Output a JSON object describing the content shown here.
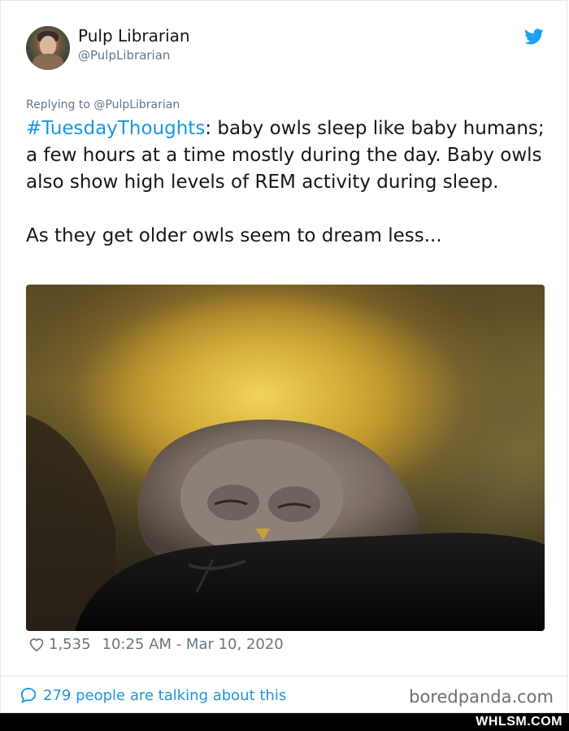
{
  "tweet": {
    "author_name": "Pulp Librarian",
    "author_handle": "@PulpLibrarian",
    "replying_to": "Replying to @PulpLibrarian",
    "hashtag": "#TuesdayThoughts",
    "text_part1": ": baby owls sleep like baby humans; a few hours at a time mostly during the day. Baby owls also show high levels of REM activity during sleep.",
    "text_part2": "As they get older owls seem to dream less...",
    "likes": "1,535",
    "timestamp": "10:25 AM - Mar 10, 2020",
    "talking": "279 people are talking about this"
  },
  "footer": {
    "source": "boredpanda.com",
    "watermark": "WHLSM.COM"
  },
  "icons": {
    "brand": "twitter-bird-icon",
    "like": "heart-icon",
    "reply": "speech-bubble-icon"
  },
  "colors": {
    "twitter_blue": "#1da1f2",
    "link": "#1b95e0",
    "muted": "#657786"
  }
}
